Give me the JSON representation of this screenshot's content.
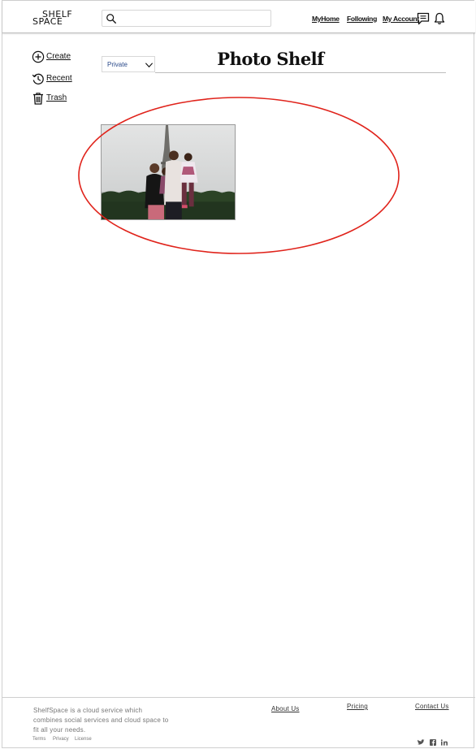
{
  "header": {
    "logo_line1": "SHELF",
    "logo_line2": "SPACE",
    "search_placeholder": "",
    "nav": {
      "home": "MyHome",
      "following": "Following",
      "account": "My Account"
    }
  },
  "sidebar": {
    "items": [
      {
        "label": "Create",
        "icon": "plus-circle-icon"
      },
      {
        "label": "Recent",
        "icon": "history-icon"
      },
      {
        "label": "Trash",
        "icon": "trash-icon"
      }
    ]
  },
  "main": {
    "privacy_value": "Private",
    "title": "Photo Shelf"
  },
  "annotation": {
    "color": "#e0231b"
  },
  "footer": {
    "description": "ShelfSpace is a cloud service which combines social services and cloud space to fit all your needs.",
    "links": {
      "about": "About Us",
      "pricing": "Pricing",
      "contact": "Contact Us"
    },
    "legal": {
      "terms": "Terms",
      "privacy": "Privacy",
      "license": "License"
    }
  }
}
